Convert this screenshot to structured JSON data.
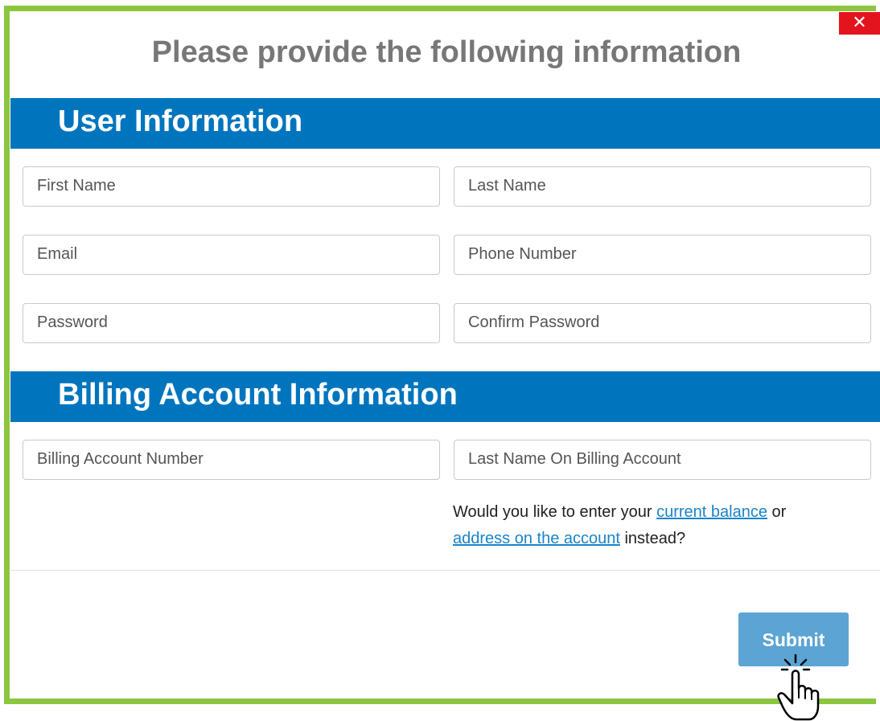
{
  "dialog": {
    "title": "Please provide the following information",
    "close_label": "✕"
  },
  "user_section": {
    "heading": "User Information",
    "fields": {
      "first_name": "First Name",
      "last_name": "Last Name",
      "email": "Email",
      "phone": "Phone Number",
      "password": "Password",
      "confirm_password": "Confirm Password"
    }
  },
  "billing_section": {
    "heading": "Billing Account Information",
    "fields": {
      "account_number": "Billing Account Number",
      "last_name": "Last Name On Billing Account"
    },
    "note": {
      "prefix": "Would you like to enter your ",
      "link1": "current balance",
      "middle": " or ",
      "link2": "address on the account",
      "suffix": " instead?"
    }
  },
  "footer": {
    "submit_label": "Submit"
  },
  "colors": {
    "frame": "#8cc63f",
    "header": "#0075be",
    "close": "#e3141e",
    "submit": "#5ba4d4",
    "link": "#1a84c9"
  },
  "icons": [
    "close-icon",
    "hand-pointer-icon"
  ]
}
